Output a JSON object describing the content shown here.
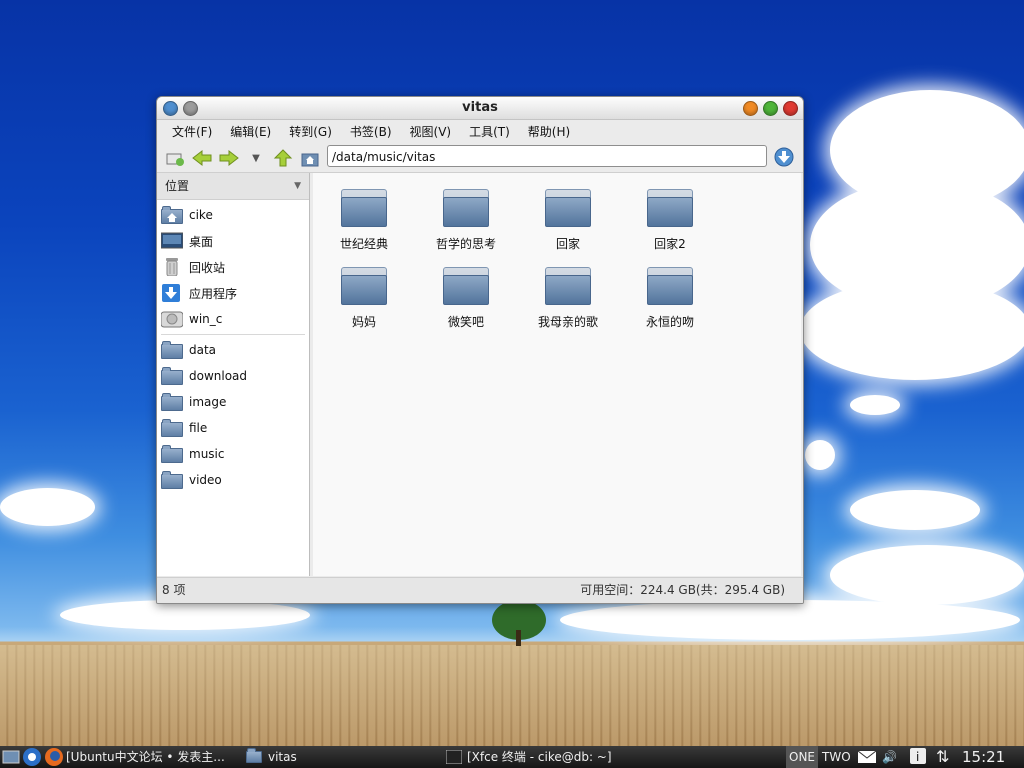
{
  "window": {
    "title": "vitas",
    "menu": [
      "文件(F)",
      "编辑(E)",
      "转到(G)",
      "书签(B)",
      "视图(V)",
      "工具(T)",
      "帮助(H)"
    ],
    "address": "/data/music/vitas"
  },
  "sidebar": {
    "header": "位置",
    "places": [
      {
        "label": "cike",
        "icon": "home-folder-icon"
      },
      {
        "label": "桌面",
        "icon": "desktop-icon"
      },
      {
        "label": "回收站",
        "icon": "trash-icon"
      },
      {
        "label": "应用程序",
        "icon": "applications-icon"
      },
      {
        "label": "win_c",
        "icon": "drive-icon"
      }
    ],
    "bookmarks": [
      {
        "label": "data",
        "icon": "folder-icon"
      },
      {
        "label": "download",
        "icon": "folder-icon"
      },
      {
        "label": "image",
        "icon": "folder-icon"
      },
      {
        "label": "file",
        "icon": "folder-icon"
      },
      {
        "label": "music",
        "icon": "folder-icon"
      },
      {
        "label": "video",
        "icon": "folder-icon"
      }
    ]
  },
  "files": [
    "世纪经典",
    "哲学的思考",
    "回家",
    "回家2",
    "妈妈",
    "微笑吧",
    "我母亲的歌",
    "永恒的吻"
  ],
  "status": {
    "count": "8 项",
    "space": "可用空间：224.4 GB(共：295.4 GB)"
  },
  "taskbar": {
    "tasks": [
      "[Ubuntu中文论坛 • 发表主...",
      "vitas",
      "[Xfce 终端 - cike@db: ~]"
    ],
    "workspaces": [
      "ONE",
      "TWO"
    ],
    "clock": "15:21"
  },
  "colors": {
    "titlebar_close": "#e03a32",
    "titlebar_max": "#4fb53a",
    "titlebar_min": "#f08a24",
    "titlebar_left": "#4f8fd0",
    "folder": "#5f7fa5"
  }
}
